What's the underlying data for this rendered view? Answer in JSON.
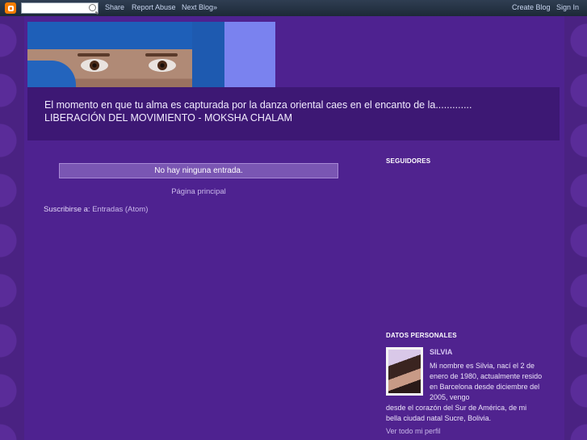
{
  "navbar": {
    "search_placeholder": "",
    "share": "Share",
    "report_abuse": "Report Abuse",
    "next_blog": "Next Blog»",
    "create_blog": "Create Blog",
    "sign_in": "Sign In"
  },
  "header": {
    "description_line1": "El momento en que tu alma es capturada por la danza oriental caes en el encanto de la.............",
    "description_line2": "LIBERACIÓN DEL MOVIMIENTO - MOKSHA CHALAM"
  },
  "main": {
    "no_posts": "No hay ninguna entrada.",
    "home_link": "Página principal",
    "subscribe_label": "Suscribirse a:",
    "subscribe_link": "Entradas (Atom)"
  },
  "sidebar": {
    "followers_title": "SEGUIDORES",
    "profile_title": "DATOS PERSONALES",
    "profile_name": "SILVIA",
    "profile_text_indented": "Mi nombre es Silvia, nací el 2 de enero de 1980, actualmente resido en Barcelona desde diciembre del 2005, vengo",
    "profile_text_full": "desde el corazón del Sur de América, de mi bella ciudad natal Sucre, Bolivia.",
    "profile_link": "Ver todo mi perfil"
  },
  "colors": {
    "page_bg": "#3b1a6e",
    "content_bg": "#4e2290",
    "navbar_bg": "#1d2938",
    "accent": "#7a82ef"
  }
}
